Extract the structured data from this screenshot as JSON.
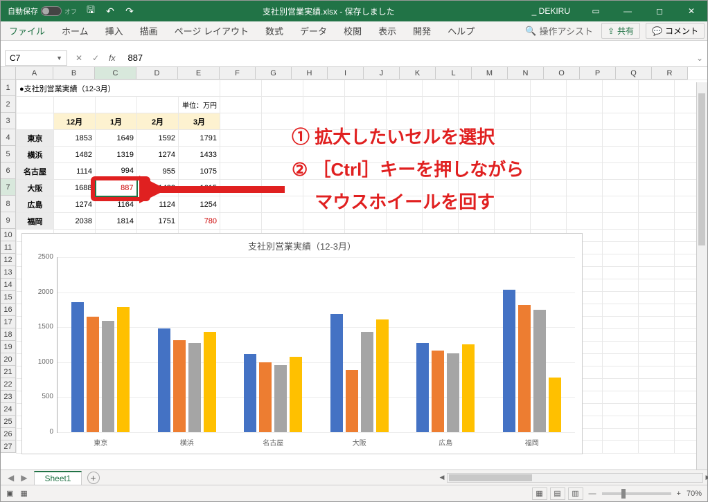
{
  "titlebar": {
    "autosave_label": "自動保存",
    "autosave_state": "オフ",
    "filename": "支社別営業実績.xlsx - 保存しました",
    "user": "_ DEKIRU"
  },
  "ribbon": {
    "tabs": [
      "ファイル",
      "ホーム",
      "挿入",
      "描画",
      "ページ レイアウト",
      "数式",
      "データ",
      "校閲",
      "表示",
      "開発",
      "ヘルプ"
    ],
    "search_placeholder": "操作アシスト",
    "share": "共有",
    "comments": "コメント"
  },
  "formula": {
    "namebox": "C7",
    "fx": "fx",
    "value": "887"
  },
  "columns": [
    {
      "l": "A",
      "w": 54
    },
    {
      "l": "B",
      "w": 60
    },
    {
      "l": "C",
      "w": 60
    },
    {
      "l": "D",
      "w": 60
    },
    {
      "l": "E",
      "w": 60
    },
    {
      "l": "F",
      "w": 52
    },
    {
      "l": "G",
      "w": 52
    },
    {
      "l": "H",
      "w": 52
    },
    {
      "l": "I",
      "w": 52
    },
    {
      "l": "J",
      "w": 52
    },
    {
      "l": "K",
      "w": 52
    },
    {
      "l": "L",
      "w": 52
    },
    {
      "l": "M",
      "w": 52
    },
    {
      "l": "N",
      "w": 52
    },
    {
      "l": "O",
      "w": 52
    },
    {
      "l": "P",
      "w": 52
    },
    {
      "l": "Q",
      "w": 52
    },
    {
      "l": "R",
      "w": 52
    }
  ],
  "rows": [
    1,
    2,
    3,
    4,
    5,
    6,
    7,
    8,
    9,
    10,
    11,
    12,
    13,
    14,
    15,
    16,
    17,
    18,
    19,
    20,
    21,
    22,
    23,
    24,
    25,
    26,
    27
  ],
  "table": {
    "title": "●支社別営業実績（12-3月）",
    "unit": "単位：万円",
    "headers": [
      "12月",
      "1月",
      "2月",
      "3月"
    ],
    "branches": [
      "東京",
      "横浜",
      "名古屋",
      "大阪",
      "広島",
      "福岡"
    ],
    "data": [
      [
        1853,
        1649,
        1592,
        1791
      ],
      [
        1482,
        1319,
        1274,
        1433
      ],
      [
        1114,
        994,
        955,
        1075
      ],
      [
        1688,
        887,
        1432,
        1615
      ],
      [
        1274,
        1164,
        1124,
        1254
      ],
      [
        2038,
        1814,
        1751,
        780
      ]
    ],
    "red_cells": [
      [
        3,
        1
      ],
      [
        5,
        3
      ]
    ]
  },
  "annotation": {
    "line1": "① 拡大したいセルを選択",
    "line2": "② ［Ctrl］キーを押しながら",
    "line3": "　 マウスホイールを回す"
  },
  "chart_data": {
    "type": "bar",
    "title": "支社別営業実績（12-3月）",
    "categories": [
      "東京",
      "横浜",
      "名古屋",
      "大阪",
      "広島",
      "福岡"
    ],
    "series": [
      {
        "name": "12月",
        "color": "#4472c4",
        "values": [
          1853,
          1482,
          1114,
          1688,
          1274,
          2038
        ]
      },
      {
        "name": "1月",
        "color": "#ed7d31",
        "values": [
          1649,
          1319,
          994,
          887,
          1164,
          1814
        ]
      },
      {
        "name": "2月",
        "color": "#a5a5a5",
        "values": [
          1592,
          1274,
          955,
          1432,
          1124,
          1751
        ]
      },
      {
        "name": "3月",
        "color": "#ffc000",
        "values": [
          1791,
          1433,
          1075,
          1615,
          1254,
          780
        ]
      }
    ],
    "ylim": [
      0,
      2500
    ],
    "yticks": [
      0,
      500,
      1000,
      1500,
      2000,
      2500
    ]
  },
  "sheet": {
    "tabs": [
      "Sheet1"
    ]
  },
  "status": {
    "zoom": "70%"
  }
}
